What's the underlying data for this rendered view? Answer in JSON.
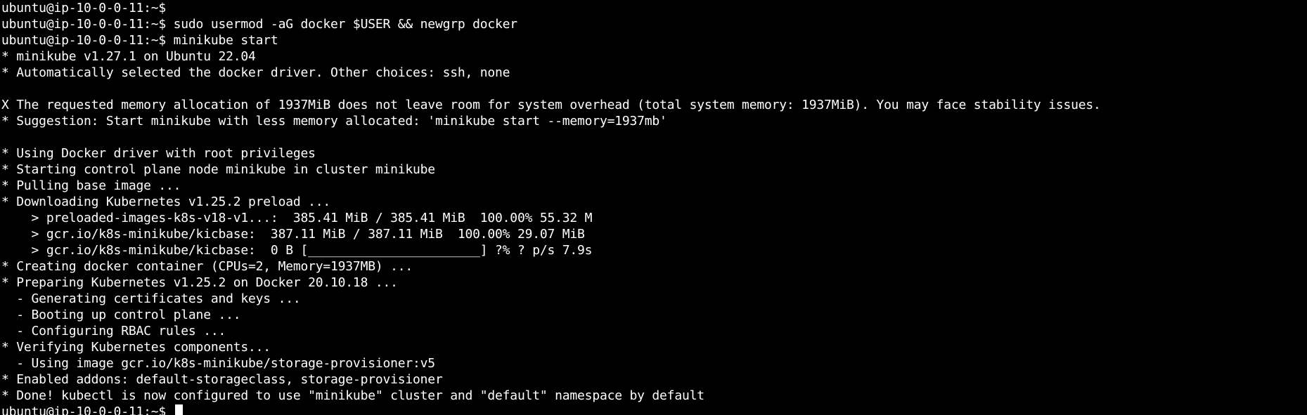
{
  "terminal": {
    "lines": [
      "ubuntu@ip-10-0-0-11:~$",
      "ubuntu@ip-10-0-0-11:~$ sudo usermod -aG docker $USER && newgrp docker",
      "ubuntu@ip-10-0-0-11:~$ minikube start",
      "* minikube v1.27.1 on Ubuntu 22.04",
      "* Automatically selected the docker driver. Other choices: ssh, none",
      "",
      "X The requested memory allocation of 1937MiB does not leave room for system overhead (total system memory: 1937MiB). You may face stability issues.",
      "* Suggestion: Start minikube with less memory allocated: 'minikube start --memory=1937mb'",
      "",
      "* Using Docker driver with root privileges",
      "* Starting control plane node minikube in cluster minikube",
      "* Pulling base image ...",
      "* Downloading Kubernetes v1.25.2 preload ...",
      "    > preloaded-images-k8s-v18-v1...:  385.41 MiB / 385.41 MiB  100.00% 55.32 M",
      "    > gcr.io/k8s-minikube/kicbase:  387.11 MiB / 387.11 MiB  100.00% 29.07 MiB",
      "    > gcr.io/k8s-minikube/kicbase:  0 B [_______________________] ?% ? p/s 7.9s",
      "* Creating docker container (CPUs=2, Memory=1937MB) ...",
      "* Preparing Kubernetes v1.25.2 on Docker 20.10.18 ...",
      "  - Generating certificates and keys ...",
      "  - Booting up control plane ...",
      "  - Configuring RBAC rules ...",
      "* Verifying Kubernetes components...",
      "  - Using image gcr.io/k8s-minikube/storage-provisioner:v5",
      "* Enabled addons: default-storageclass, storage-provisioner",
      "* Done! kubectl is now configured to use \"minikube\" cluster and \"default\" namespace by default"
    ],
    "prompt": "ubuntu@ip-10-0-0-11:~$"
  }
}
